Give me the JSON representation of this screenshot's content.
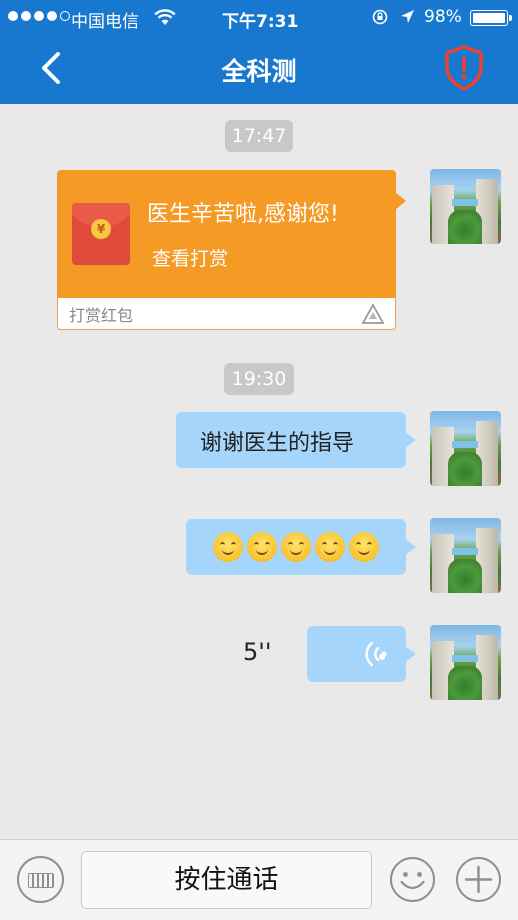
{
  "status_bar": {
    "carrier": "中国电信",
    "time": "下午7:31",
    "battery": "98%",
    "signal_bars_filled": 4,
    "signal_bars_total": 5
  },
  "nav": {
    "title": "全科测"
  },
  "messages": {
    "time1": "17:47",
    "red_packet": {
      "message": "医生辛苦啦,感谢您!",
      "action": "查看打赏",
      "label": "打赏红包",
      "coin_symbol": "¥"
    },
    "time2": "19:30",
    "text": "谢谢医生的指导",
    "emoji_count": 5,
    "voice_duration": "5''"
  },
  "input_bar": {
    "talk_label": "按住通话"
  },
  "colors": {
    "nav_bg": "#1878cf",
    "bubble": "#a5d5fb",
    "red_packet": "#f59a25",
    "shield": "#e8432f"
  }
}
